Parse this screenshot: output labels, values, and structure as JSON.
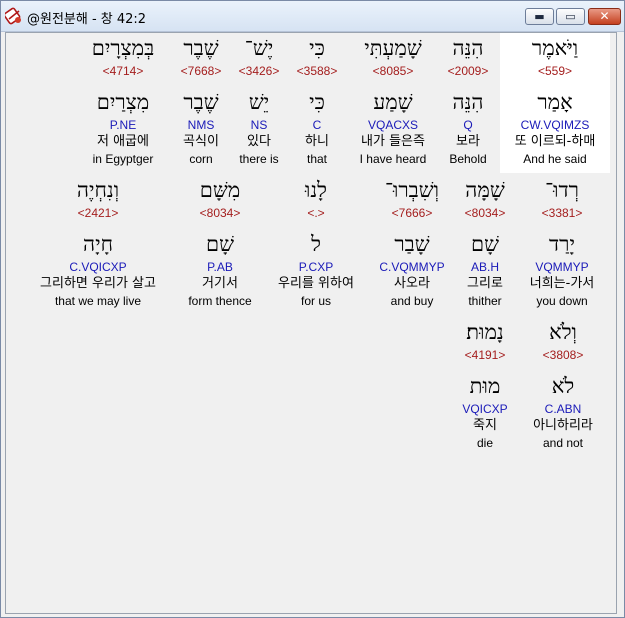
{
  "window": {
    "title": "@원전분해 - 창 42:2"
  },
  "controls": {
    "minimize": "▬",
    "maximize": "▭",
    "close": "✕"
  },
  "icons": {
    "app": "app-icon",
    "minimize": "minimize-icon",
    "maximize": "maximize-icon",
    "close": "close-icon"
  },
  "colors": {
    "code": "#a41e1e",
    "parse": "#1a1ab8",
    "highlight": "#ffffff"
  },
  "words": [
    {
      "hebrew": "וַיֹּאמֶר",
      "code": "<559>",
      "lemma": "אָמַר",
      "parse": "CW.VQIMZS",
      "korean": "또 이르되-하매",
      "english": "And he said"
    },
    {
      "hebrew": "הִנֵּה",
      "code": "<2009>",
      "lemma": "הִנֵּה",
      "parse": "Q",
      "korean": "보라",
      "english": "Behold"
    },
    {
      "hebrew": "שָׁמַעְתִּי",
      "code": "<8085>",
      "lemma": "שָׁמַע",
      "parse": "VQACXS",
      "korean": "내가 들은즉",
      "english": "I have heard"
    },
    {
      "hebrew": "כִּי",
      "code": "<3588>",
      "lemma": "כִּי",
      "parse": "C",
      "korean": "하니",
      "english": "that"
    },
    {
      "hebrew": "יֶשׁ־",
      "code": "<3426>",
      "lemma": "יֵשׁ",
      "parse": "NS",
      "korean": "있다",
      "english": "there is"
    },
    {
      "hebrew": "שֶׁבֶר",
      "code": "<7668>",
      "lemma": "שֶׁבֶר",
      "parse": "NMS",
      "korean": "곡식이",
      "english": "corn"
    },
    {
      "hebrew": "בְּמִצְרָיִם",
      "code": "<4714>",
      "lemma": "מִצְרַיִם",
      "parse": "P.NE",
      "korean": "저 애굽에",
      "english": "in Egyptger"
    },
    {
      "hebrew": "רְדוּ־",
      "code": "<3381>",
      "lemma": "יָרַד",
      "parse": "VQMMYP",
      "korean": "너희는-가서",
      "english": "you down"
    },
    {
      "hebrew": "שָׁמָּה",
      "code": "<8034>",
      "lemma": "שָׁם",
      "parse": "AB.H",
      "korean": "그리로",
      "english": "thither"
    },
    {
      "hebrew": "וְשִׁבְרוּ־",
      "code": "<7666>",
      "lemma": "שָׁבַר",
      "parse": "C.VQMMYP",
      "korean": "사오라",
      "english": "and buy"
    },
    {
      "hebrew": "לָנוּ",
      "code": "<.>",
      "lemma": "ל",
      "parse": "P.CXP",
      "korean": "우리를 위하여",
      "english": "for us"
    },
    {
      "hebrew": "מִשָּׁם",
      "code": "<8034>",
      "lemma": "שָׁם",
      "parse": "P.AB",
      "korean": "거기서",
      "english": "form thence"
    },
    {
      "hebrew": "וְנִחְיֶה",
      "code": "<2421>",
      "lemma": "חָיָה",
      "parse": "C.VQICXP",
      "korean": "그리하면 우리가 살고",
      "english": "that we may live"
    },
    {
      "hebrew": "וְלֹא",
      "code": "<3808>",
      "lemma": "לֹא",
      "parse": "C.ABN",
      "korean": "아니하리라",
      "english": "and not"
    },
    {
      "hebrew": "נָמוּת׃",
      "code": "<4191>",
      "lemma": "מוּת",
      "parse": "VQICXP",
      "korean": "죽지",
      "english": "die"
    }
  ]
}
